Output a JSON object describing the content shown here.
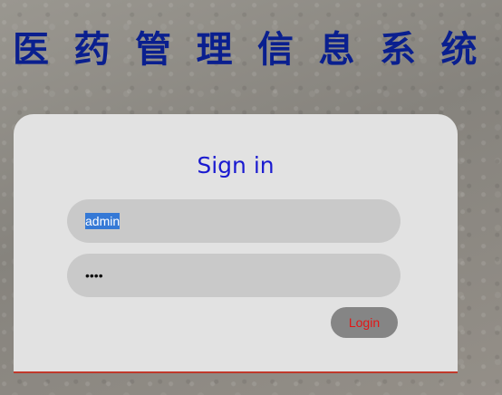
{
  "header": {
    "title_chars": [
      "医",
      "药",
      "管",
      "理",
      "信",
      "息",
      "系",
      "统"
    ]
  },
  "login_form": {
    "heading": "Sign in",
    "username_value": "admin",
    "password_value": "••••",
    "login_label": "Login"
  },
  "colors": {
    "title": "#0a1f8f",
    "heading": "#1a1ad0",
    "login_text": "#e31616",
    "card_bg": "#e2e2e2",
    "field_bg": "#c9c9c9",
    "button_bg": "#858585",
    "selection": "#3579d6"
  }
}
